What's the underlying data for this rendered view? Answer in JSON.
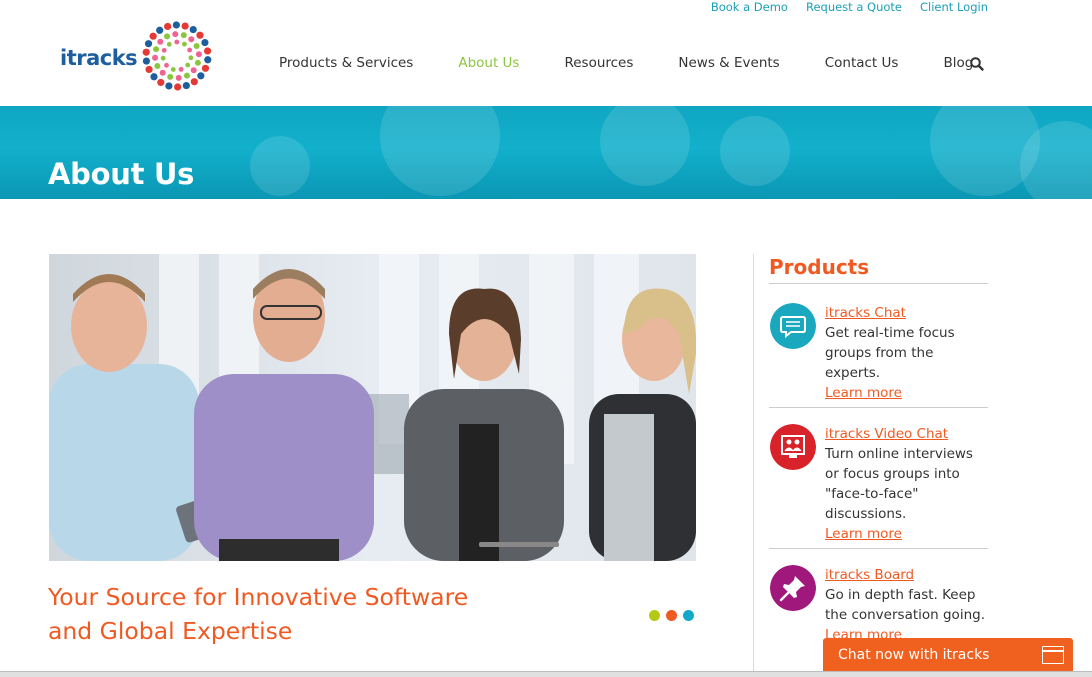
{
  "utility_links": {
    "book_demo": "Book a Demo",
    "request_quote": "Request a Quote",
    "client_login": "Client Login"
  },
  "brand": {
    "logo_text": "itracks",
    "logo_colors": [
      "#e53935",
      "#f5a623",
      "#8cc63f",
      "#12a9c8",
      "#1d5f9e",
      "#9c27b0",
      "#f06292",
      "#555555"
    ]
  },
  "nav": {
    "items": [
      {
        "label": "Products & Services",
        "active": false
      },
      {
        "label": "About Us",
        "active": true
      },
      {
        "label": "Resources",
        "active": false
      },
      {
        "label": "News & Events",
        "active": false
      },
      {
        "label": "Contact Us",
        "active": false
      },
      {
        "label": "Blog",
        "active": false
      }
    ],
    "search_icon": "search-icon",
    "active_color": "#8cc63f"
  },
  "banner": {
    "title": "About Us",
    "color": "#12b0cc"
  },
  "slider": {
    "tagline": "Your Source for Innovative Software and Global Expertise",
    "dot_colors": [
      "#b5c914",
      "#f05a22",
      "#12a9c8"
    ]
  },
  "sidebar": {
    "title": "Products",
    "products": [
      {
        "name": "itracks Chat",
        "description": "Get real-time focus groups from the experts.",
        "link": "Learn more",
        "icon": "chat-bubble-icon",
        "icon_color": "#1aa8bf"
      },
      {
        "name": "itracks Video Chat",
        "description": "Turn online interviews or focus groups into \"face-to-face\" discussions.",
        "link": "Learn more",
        "icon": "video-chat-icon",
        "icon_color": "#d8232a"
      },
      {
        "name": "itracks Board",
        "description": "Go in depth fast. Keep the conversation going.",
        "link": "Learn more",
        "icon": "pushpin-icon",
        "icon_color": "#a0187c"
      }
    ]
  },
  "chat_widget": {
    "label": "Chat now with itracks",
    "color": "#f0611f"
  }
}
